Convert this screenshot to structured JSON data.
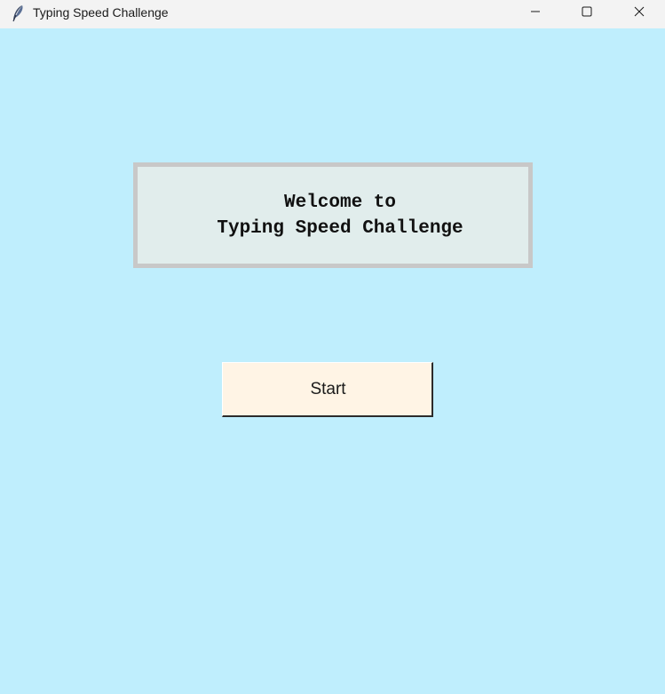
{
  "window": {
    "title": "Typing Speed Challenge",
    "icon": "feather-icon",
    "controls": [
      "minimize-icon",
      "maximize-icon",
      "close-icon"
    ],
    "background_color": "#bfeefd"
  },
  "welcome": {
    "line1": "Welcome to",
    "line2": "Typing Speed Challenge",
    "background_color": "#e1edec",
    "border_color": "#c8c8c8"
  },
  "start_button": {
    "label": "Start",
    "background_color": "#fff4e5"
  }
}
